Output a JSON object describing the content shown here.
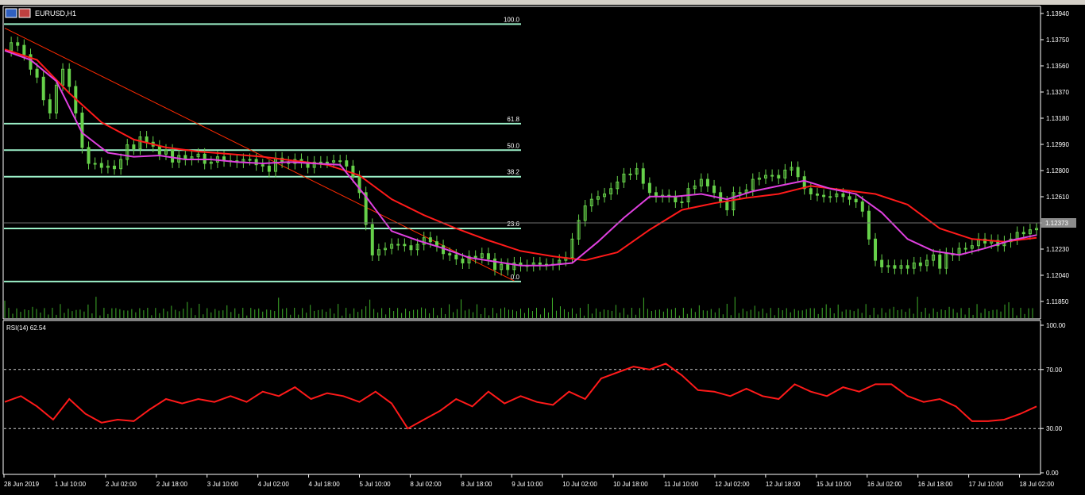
{
  "window": {
    "title": "EURUSD,H1",
    "icon": "chart-window-icon"
  },
  "colors": {
    "background": "#000000",
    "axis": "#ffffff",
    "candle_up": "#66d14a",
    "fib": "#9cf0c8",
    "trendline": "#ff2a00",
    "ma_slow": "#ff1a1a",
    "ma_fast": "#e040e0",
    "volume": "#3fae2a",
    "rsi": "#ff1a1a",
    "price_marker_bg": "#8c8c8c"
  },
  "price_axis": {
    "labels": [
      "1.13940",
      "1.13750",
      "1.13560",
      "1.13370",
      "1.13180",
      "1.12990",
      "1.12800",
      "1.12610",
      "1.12420",
      "1.12230",
      "1.12040",
      "1.11850"
    ],
    "current_price": "1.12373"
  },
  "rsi_panel": {
    "label": "RSI(14) 62.54",
    "levels": [
      "100.00",
      "70.00",
      "30.00",
      "0.00"
    ]
  },
  "time_axis": {
    "labels": [
      "28 Jun 2019",
      "1 Jul 10:00",
      "2 Jul 02:00",
      "2 Jul 18:00",
      "3 Jul 10:00",
      "4 Jul 02:00",
      "4 Jul 18:00",
      "5 Jul 10:00",
      "8 Jul 02:00",
      "8 Jul 18:00",
      "9 Jul 10:00",
      "10 Jul 02:00",
      "10 Jul 18:00",
      "11 Jul 10:00",
      "12 Jul 02:00",
      "12 Jul 18:00",
      "15 Jul 10:00",
      "16 Jul 02:00",
      "16 Jul 18:00",
      "17 Jul 10:00",
      "18 Jul 02:00"
    ]
  },
  "fibonacci": {
    "levels": [
      {
        "label": "100.0",
        "price": 1.1392
      },
      {
        "label": "61.8",
        "price": 1.1317
      },
      {
        "label": "50.0",
        "price": 1.1297
      },
      {
        "label": "38.2",
        "price": 1.1277
      },
      {
        "label": "23.6",
        "price": 1.1238
      },
      {
        "label": "0.0",
        "price": 1.1198
      }
    ]
  },
  "chart_data": {
    "type": "line",
    "symbol": "EURUSD",
    "timeframe": "H1",
    "y_range": [
      1.1177,
      1.14
    ],
    "rsi_range": [
      0,
      100
    ],
    "price_close": {
      "x": [
        0,
        2,
        4,
        6,
        8,
        10,
        12,
        14,
        16,
        18,
        20,
        22,
        24,
        26,
        28,
        30,
        32,
        34,
        36,
        38,
        40,
        42,
        44,
        46,
        48,
        50,
        52,
        54,
        56,
        58,
        60,
        62,
        64,
        66,
        68,
        70,
        72,
        74,
        76,
        78,
        80,
        82,
        84,
        86,
        88,
        90,
        92,
        94,
        96,
        98,
        100,
        102,
        104,
        106,
        108,
        110,
        112,
        114,
        116,
        118,
        120,
        122,
        124,
        126,
        128,
        130,
        132,
        134,
        136,
        138,
        140,
        142,
        144,
        146,
        148,
        150,
        152,
        154,
        156,
        158,
        160,
        162,
        164,
        166,
        168,
        170,
        172,
        174,
        176,
        178,
        180,
        182,
        184,
        186,
        188,
        190,
        192,
        194,
        196,
        198,
        200,
        202,
        204,
        206,
        208,
        210,
        212,
        214,
        216,
        218,
        220,
        222,
        224,
        226,
        228,
        230,
        232,
        234,
        236,
        238,
        240,
        242,
        244,
        246,
        248,
        250,
        252,
        254,
        256,
        258,
        260,
        262,
        264,
        266,
        268,
        270,
        272,
        274,
        276,
        278,
        280,
        282,
        284,
        286,
        288,
        290,
        292,
        294,
        296,
        298,
        300,
        302,
        304,
        306,
        308,
        310,
        312,
        314,
        316,
        318,
        320
      ],
      "y": [
        1.1372,
        1.1378,
        1.1376,
        1.1369,
        1.1358,
        1.1352,
        1.1335,
        1.1325,
        1.1346,
        1.1358,
        1.1345,
        1.1325,
        1.1299,
        1.1287,
        1.1287,
        1.1284,
        1.1285,
        1.1283,
        1.129,
        1.1301,
        1.1298,
        1.1307,
        1.1303,
        1.13,
        1.1294,
        1.1297,
        1.1288,
        1.1293,
        1.129,
        1.1292,
        1.1294,
        1.1287,
        1.1288,
        1.1292,
        1.1289,
        1.1289,
        1.1288,
        1.129,
        1.129,
        1.1286,
        1.1285,
        1.1281,
        1.1291,
        1.1288,
        1.1287,
        1.129,
        1.1288,
        1.1284,
        1.1288,
        1.1288,
        1.1288,
        1.1289,
        1.1289,
        1.1285,
        1.1277,
        1.1265,
        1.1241,
        1.1218,
        1.1222,
        1.1223,
        1.1226,
        1.1226,
        1.1225,
        1.1222,
        1.1226,
        1.1231,
        1.1228,
        1.1225,
        1.1219,
        1.1218,
        1.1215,
        1.1212,
        1.1217,
        1.1216,
        1.1219,
        1.1215,
        1.1207,
        1.1211,
        1.1207,
        1.1212,
        1.121,
        1.121,
        1.1212,
        1.1211,
        1.1211,
        1.1211,
        1.1214,
        1.1216,
        1.123,
        1.1244,
        1.1255,
        1.126,
        1.1262,
        1.1264,
        1.1268,
        1.1273,
        1.1279,
        1.1279,
        1.1283,
        1.1272,
        1.1265,
        1.1262,
        1.1263,
        1.1262,
        1.1258,
        1.1258,
        1.1268,
        1.127,
        1.1275,
        1.127,
        1.1265,
        1.1258,
        1.1252,
        1.1265,
        1.1265,
        1.1267,
        1.1275,
        1.1276,
        1.1278,
        1.1278,
        1.1276,
        1.1282,
        1.1284,
        1.1277,
        1.1268,
        1.1264,
        1.1263,
        1.1262,
        1.1262,
        1.1264,
        1.1262,
        1.126,
        1.1258,
        1.1251,
        1.123,
        1.1214,
        1.1209,
        1.121,
        1.1208,
        1.121,
        1.1208,
        1.1212,
        1.121,
        1.1214,
        1.1218,
        1.1208,
        1.1219,
        1.1218,
        1.1223,
        1.1223,
        1.1225,
        1.123,
        1.1227,
        1.1229,
        1.1225,
        1.1228,
        1.123,
        1.1235,
        1.1234,
        1.1237,
        1.1238,
        1.1237,
        1.1237,
        1.1237,
        1.1237
      ]
    },
    "ma_fast": {
      "x": [
        0,
        8,
        16,
        24,
        32,
        40,
        48,
        56,
        64,
        72,
        80,
        88,
        96,
        104,
        112,
        120,
        128,
        136,
        144,
        152,
        160,
        168,
        176,
        184,
        192,
        200,
        208,
        216,
        224,
        232,
        240,
        248,
        256,
        264,
        272,
        280,
        288,
        296,
        304,
        312,
        320
      ],
      "y": [
        1.1372,
        1.1365,
        1.1349,
        1.131,
        1.1295,
        1.1292,
        1.1293,
        1.129,
        1.129,
        1.1288,
        1.1287,
        1.1288,
        1.1287,
        1.1286,
        1.1262,
        1.1236,
        1.1229,
        1.1223,
        1.1216,
        1.1213,
        1.121,
        1.121,
        1.1212,
        1.1228,
        1.1246,
        1.1262,
        1.1262,
        1.1264,
        1.126,
        1.1266,
        1.127,
        1.1274,
        1.1268,
        1.1264,
        1.125,
        1.123,
        1.1221,
        1.1218,
        1.1223,
        1.1229,
        1.1233
      ]
    },
    "ma_slow": {
      "x": [
        0,
        10,
        20,
        30,
        40,
        50,
        60,
        70,
        80,
        90,
        100,
        110,
        120,
        130,
        140,
        150,
        160,
        170,
        180,
        190,
        200,
        210,
        220,
        230,
        240,
        250,
        260,
        270,
        280,
        290,
        300,
        310,
        320
      ],
      "y": [
        1.1373,
        1.1365,
        1.134,
        1.1318,
        1.1305,
        1.1299,
        1.1296,
        1.1294,
        1.1292,
        1.1289,
        1.1286,
        1.1278,
        1.126,
        1.1248,
        1.1238,
        1.1229,
        1.1221,
        1.1217,
        1.1214,
        1.122,
        1.1237,
        1.1252,
        1.1257,
        1.1261,
        1.1264,
        1.127,
        1.1267,
        1.1264,
        1.1256,
        1.1238,
        1.123,
        1.1228,
        1.1231
      ]
    },
    "rsi": {
      "x": [
        0,
        5,
        10,
        15,
        20,
        25,
        30,
        35,
        40,
        45,
        50,
        55,
        60,
        65,
        70,
        75,
        80,
        85,
        90,
        95,
        100,
        105,
        110,
        115,
        120,
        125,
        130,
        135,
        140,
        145,
        150,
        155,
        160,
        165,
        170,
        175,
        180,
        185,
        190,
        195,
        200,
        205,
        210,
        215,
        220,
        225,
        230,
        235,
        240,
        245,
        250,
        255,
        260,
        265,
        270,
        275,
        280,
        285,
        290,
        295,
        300,
        305,
        310,
        315,
        320
      ],
      "y": [
        48,
        52,
        45,
        36,
        50,
        40,
        34,
        36,
        35,
        43,
        50,
        47,
        50,
        48,
        52,
        48,
        55,
        52,
        58,
        50,
        54,
        52,
        48,
        55,
        47,
        30,
        36,
        42,
        50,
        45,
        55,
        47,
        52,
        48,
        46,
        55,
        50,
        64,
        68,
        72,
        70,
        74,
        66,
        56,
        55,
        52,
        57,
        52,
        50,
        60,
        55,
        52,
        58,
        55,
        60,
        60,
        52,
        48,
        50,
        45,
        35,
        35,
        36,
        40,
        45
      ]
    },
    "volume_scale": "relative"
  }
}
